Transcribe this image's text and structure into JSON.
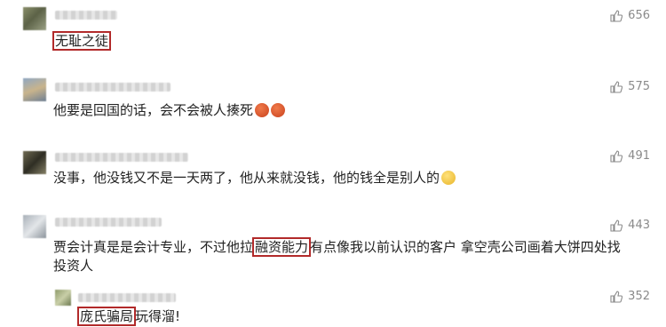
{
  "comments": [
    {
      "text": "无耻之徒",
      "likes": "656"
    },
    {
      "text": "他要是回国的话，会不会被人揍死",
      "likes": "575",
      "emoji": "angry-emoji"
    },
    {
      "text": "没事，他没钱又不是一天两了，他从来就没钱，他的钱全是别人的",
      "likes": "491",
      "emoji": "laugh-emoji"
    },
    {
      "text_a": "贾会计真是是会计专业，不过他拉",
      "text_hl": "融资能力",
      "text_b": "有点像我以前认识的客户 拿空壳公司画着大饼四处找",
      "text_line2": "投资人",
      "likes": "443"
    },
    {
      "text_hl": "庞氏骗局",
      "text_b": "玩得溜!",
      "likes": "352"
    }
  ],
  "colors": {
    "highlight_box": "#b22a2a",
    "like_count": "#8a8a8a"
  },
  "icons": {
    "like": "thumbs-up-icon"
  }
}
